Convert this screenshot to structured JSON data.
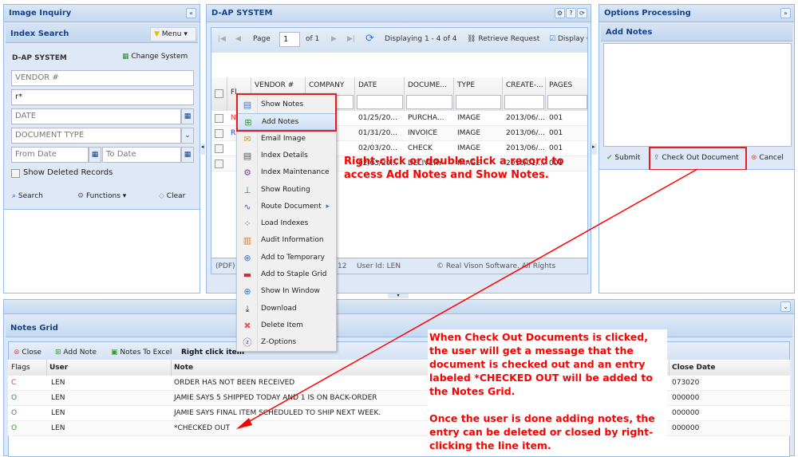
{
  "left": {
    "title": "Image Inquiry",
    "collapse": "«",
    "section": "Index Search",
    "menu": "Menu ▾",
    "system": "D-AP SYSTEM",
    "change_system": "Change System",
    "vendor_placeholder": "VENDOR #",
    "company_value": "r*",
    "date_placeholder": "DATE",
    "doctype_placeholder": "DOCUMENT TYPE",
    "from_placeholder": "From Date",
    "to_placeholder": "To Date",
    "show_deleted": "Show Deleted Records",
    "search": "Search",
    "functions": "Functions ▾",
    "clear": "Clear"
  },
  "center": {
    "title": "D-AP SYSTEM",
    "page_label": "Page",
    "page_value": "1",
    "of": "of 1",
    "displaying": "Displaying 1 - 4 of 4",
    "retrieve": "Retrieve Request",
    "display": "Display C",
    "columns": [
      "Fl...",
      "VENDOR #",
      "COMPANY",
      "DATE",
      "DOCUME...",
      "TYPE",
      "CREATE-...",
      "PAGES"
    ],
    "rows": [
      {
        "flag": "N",
        "flag_color": "#e33",
        "date": "01/25/20...",
        "doc": "PURCHA...",
        "type": "IMAGE",
        "created": "2013/06/...",
        "pages": "001"
      },
      {
        "flag": "R",
        "flag_color": "#33c",
        "date": "01/31/20...",
        "doc": "INVOICE",
        "type": "IMAGE",
        "created": "2013/06/...",
        "pages": "001"
      },
      {
        "flag": "",
        "flag_color": "#222",
        "date": "02/03/20...",
        "doc": "CHECK",
        "type": "IMAGE",
        "created": "2013/06/...",
        "pages": "001"
      },
      {
        "flag": "",
        "flag_color": "#222",
        "date": "02/03/20...",
        "doc": "DELIVERY",
        "type": "IMAGE",
        "created": "2016/01/...",
        "pages": "001"
      }
    ],
    "status_pdf": "(PDF)",
    "status_num": "12",
    "status_user": "User Id: LEN",
    "status_copy": "© Real Vison Software. All Rights Reserved."
  },
  "context_menu": [
    "Show Notes",
    "Add Notes",
    "Email Image",
    "Index Details",
    "Index Maintenance",
    "Show Routing",
    "Route Document",
    "Load Indexes",
    "Audit Information",
    "Add to Temporary",
    "Add to Staple Grid",
    "Show In Window",
    "Download",
    "Delete Item",
    "Z-Options"
  ],
  "right": {
    "title": "Options Processing",
    "expand": "»",
    "section": "Add Notes",
    "submit": "Submit",
    "checkout": "Check Out Document",
    "cancel": "Cancel"
  },
  "notes": {
    "title": "Notes Grid",
    "close": "Close",
    "add_note": "Add Note",
    "excel": "Notes To Excel",
    "hint": "Right click item",
    "columns": [
      "Flags",
      "User",
      "Note",
      "Close Date"
    ],
    "rows": [
      {
        "flag": "C",
        "flag_color": "#e33",
        "user": "LEN",
        "note": "ORDER HAS NOT BEEN RECEIVED",
        "close": "073020"
      },
      {
        "flag": "O",
        "flag_color": "#393",
        "user": "LEN",
        "note": "JAMIE SAYS 5 SHIPPED TODAY AND 1 IS ON BACK-ORDER",
        "close": "000000"
      },
      {
        "flag": "O",
        "flag_color": "#393",
        "user": "LEN",
        "note": "JAMIE SAYS FINAL ITEM SCHEDULED TO SHIP NEXT WEEK.",
        "close": "000000"
      },
      {
        "flag": "O",
        "flag_color": "#393",
        "user": "LEN",
        "note": "*CHECKED OUT",
        "close": "000000"
      }
    ]
  },
  "annotations": {
    "a1": "Right-click or double-click a record to access Add Notes and Show Notes.",
    "a2": "When Check Out Documents is clicked, the user will get a message that the document is checked out and an entry labeled *CHECKED OUT will be added to the Notes Grid.",
    "a3": "Once the user is done adding notes, the entry can be deleted or closed by right-clicking the line item."
  }
}
